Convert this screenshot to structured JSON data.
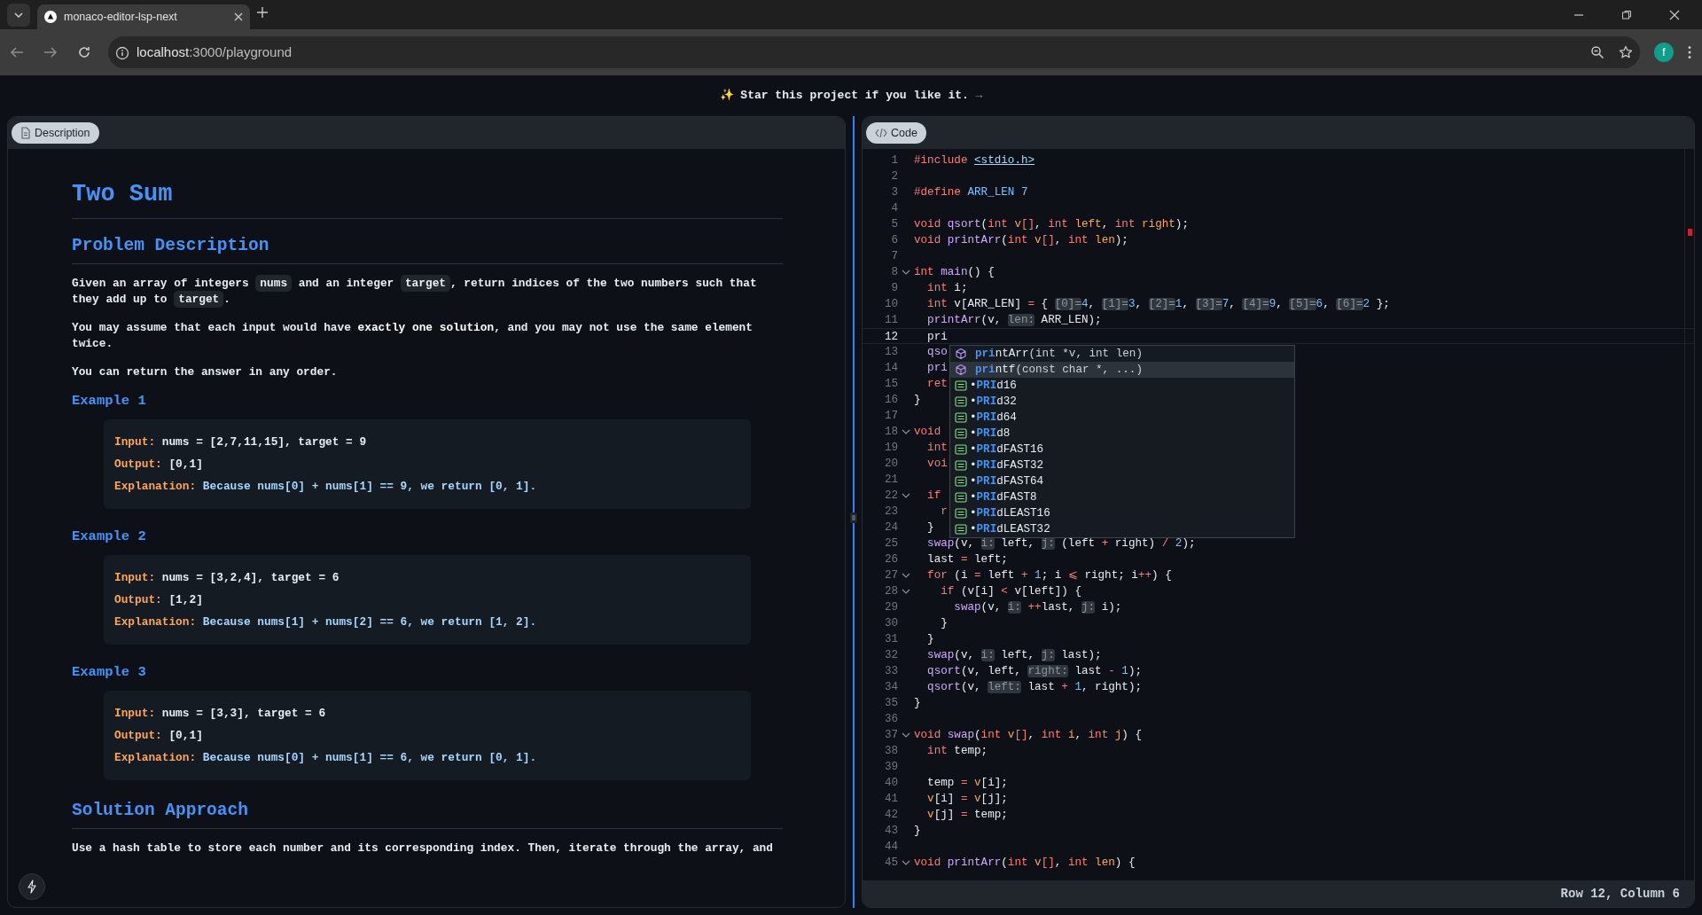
{
  "browser": {
    "tab_title": "monaco-editor-lsp-next",
    "url_host": "localhost",
    "url_path": ":3000/playground",
    "profile_initial": "f"
  },
  "banner": {
    "text": "✨ Star this project if you like it.",
    "arrow": "→"
  },
  "description_panel": {
    "tab": "Description",
    "title": "Two Sum",
    "sections": [
      {
        "kind": "h2",
        "text": "Problem Description"
      },
      {
        "kind": "p",
        "segs": [
          {
            "kind": "text",
            "text": "Given an array of integers "
          },
          {
            "kind": "code",
            "text": "nums"
          },
          {
            "kind": "text",
            "text": " and an integer "
          },
          {
            "kind": "code",
            "text": "target"
          },
          {
            "kind": "text",
            "text": ", return indices of the two numbers such that they add up to "
          },
          {
            "kind": "code",
            "text": "target"
          },
          {
            "kind": "text",
            "text": "."
          }
        ]
      },
      {
        "kind": "p",
        "segs": [
          {
            "kind": "text",
            "text": "You may assume that each input would have "
          },
          {
            "kind": "bold",
            "text": "exactly one solution"
          },
          {
            "kind": "text",
            "text": ", and you may not use the same element twice."
          }
        ]
      },
      {
        "kind": "p",
        "segs": [
          {
            "kind": "text",
            "text": "You can return the answer in any order."
          }
        ]
      },
      {
        "kind": "h3",
        "text": "Example 1"
      },
      {
        "kind": "example",
        "lines": [
          {
            "label": "Input:",
            "value": "nums = [2,7,11,15], target = 9",
            "kind": "plain"
          },
          {
            "label": "Output:",
            "value": "[0,1]",
            "kind": "plain"
          },
          {
            "label": "Explanation:",
            "value": "Because nums[0] + nums[1] == 9, we return [0, 1].",
            "kind": "note"
          }
        ]
      },
      {
        "kind": "h3",
        "text": "Example 2"
      },
      {
        "kind": "example",
        "lines": [
          {
            "label": "Input:",
            "value": "nums = [3,2,4], target = 6",
            "kind": "plain"
          },
          {
            "label": "Output:",
            "value": "[1,2]",
            "kind": "plain"
          },
          {
            "label": "Explanation:",
            "value": "Because nums[1] + nums[2] == 6, we return [1, 2].",
            "kind": "note"
          }
        ]
      },
      {
        "kind": "h3",
        "text": "Example 3"
      },
      {
        "kind": "example",
        "lines": [
          {
            "label": "Input:",
            "value": "nums = [3,3], target = 6",
            "kind": "plain"
          },
          {
            "label": "Output:",
            "value": "[0,1]",
            "kind": "plain"
          },
          {
            "label": "Explanation:",
            "value": "Because nums[0] + nums[1] == 6, we return [0, 1].",
            "kind": "note"
          }
        ]
      },
      {
        "kind": "h2",
        "text": "Solution Approach"
      },
      {
        "kind": "p",
        "segs": [
          {
            "kind": "text",
            "text": "Use a hash table to store each number and its corresponding index. Then, iterate through the array, and"
          }
        ]
      }
    ]
  },
  "code_panel": {
    "tab": "Code",
    "status": "Row 12, Column 6",
    "lines": [
      {
        "n": "1",
        "fold": false,
        "current": false,
        "segs": [
          {
            "kind": "pp",
            "text": "#include "
          },
          {
            "kind": "str",
            "text": "<stdio.h>"
          }
        ]
      },
      {
        "n": "2",
        "fold": false,
        "current": false
      },
      {
        "n": "3",
        "fold": false,
        "current": false,
        "segs": [
          {
            "kind": "pp",
            "text": "#define "
          },
          {
            "kind": "mac",
            "text": "ARR_LEN "
          },
          {
            "kind": "num",
            "text": "7"
          }
        ]
      },
      {
        "n": "4",
        "fold": false,
        "current": false
      },
      {
        "n": "5",
        "fold": false,
        "current": false,
        "segs": [
          {
            "kind": "kw",
            "text": "void "
          },
          {
            "kind": "fn",
            "text": "qsort"
          },
          {
            "kind": "p",
            "text": "("
          },
          {
            "kind": "kw",
            "text": "int "
          },
          {
            "kind": "par",
            "text": "v"
          },
          {
            "kind": "op",
            "text": "[]"
          },
          {
            "kind": "p",
            "text": ", "
          },
          {
            "kind": "kw",
            "text": "int "
          },
          {
            "kind": "par",
            "text": "left"
          },
          {
            "kind": "p",
            "text": ", "
          },
          {
            "kind": "kw",
            "text": "int "
          },
          {
            "kind": "par",
            "text": "right"
          },
          {
            "kind": "p",
            "text": ");"
          }
        ]
      },
      {
        "n": "6",
        "fold": false,
        "current": false,
        "segs": [
          {
            "kind": "kw",
            "text": "void "
          },
          {
            "kind": "fn",
            "text": "printArr"
          },
          {
            "kind": "p",
            "text": "("
          },
          {
            "kind": "kw",
            "text": "int "
          },
          {
            "kind": "par",
            "text": "v"
          },
          {
            "kind": "op",
            "text": "[]"
          },
          {
            "kind": "p",
            "text": ", "
          },
          {
            "kind": "kw",
            "text": "int "
          },
          {
            "kind": "par",
            "text": "len"
          },
          {
            "kind": "p",
            "text": ");"
          }
        ]
      },
      {
        "n": "7",
        "fold": false,
        "current": false
      },
      {
        "n": "8",
        "fold": true,
        "current": false,
        "segs": [
          {
            "kind": "kw",
            "text": "int "
          },
          {
            "kind": "fn",
            "text": "main"
          },
          {
            "kind": "p",
            "text": "() {"
          }
        ]
      },
      {
        "n": "9",
        "fold": false,
        "current": false,
        "segs": [
          {
            "kind": "kw",
            "text": "  int "
          },
          {
            "kind": "p",
            "text": "i;"
          }
        ]
      },
      {
        "n": "10",
        "fold": false,
        "current": false,
        "segs": [
          {
            "kind": "kw",
            "text": "  int "
          },
          {
            "kind": "p",
            "text": "v[ARR_LEN] "
          },
          {
            "kind": "op",
            "text": "="
          },
          {
            "kind": "p",
            "text": " { "
          },
          {
            "kind": "hint",
            "text": "[0]="
          },
          {
            "kind": "num",
            "text": "4"
          },
          {
            "kind": "p",
            "text": ", "
          },
          {
            "kind": "hint",
            "text": "[1]="
          },
          {
            "kind": "num",
            "text": "3"
          },
          {
            "kind": "p",
            "text": ", "
          },
          {
            "kind": "hint",
            "text": "[2]="
          },
          {
            "kind": "num",
            "text": "1"
          },
          {
            "kind": "p",
            "text": ", "
          },
          {
            "kind": "hint",
            "text": "[3]="
          },
          {
            "kind": "num",
            "text": "7"
          },
          {
            "kind": "p",
            "text": ", "
          },
          {
            "kind": "hint",
            "text": "[4]="
          },
          {
            "kind": "num",
            "text": "9"
          },
          {
            "kind": "p",
            "text": ", "
          },
          {
            "kind": "hint",
            "text": "[5]="
          },
          {
            "kind": "num",
            "text": "6"
          },
          {
            "kind": "p",
            "text": ", "
          },
          {
            "kind": "hint",
            "text": "[6]="
          },
          {
            "kind": "num",
            "text": "2"
          },
          {
            "kind": "p",
            "text": " };"
          }
        ]
      },
      {
        "n": "11",
        "fold": false,
        "current": false,
        "segs": [
          {
            "kind": "fn",
            "text": "  printArr"
          },
          {
            "kind": "p",
            "text": "(v, "
          },
          {
            "kind": "hint",
            "text": "len:"
          },
          {
            "kind": "p",
            "text": " ARR_LEN);"
          }
        ]
      },
      {
        "n": "12",
        "fold": false,
        "current": true,
        "segs": [
          {
            "kind": "p",
            "text": "  pri"
          }
        ]
      },
      {
        "n": "13",
        "fold": false,
        "current": false,
        "segs": [
          {
            "kind": "fn",
            "text": "  qso"
          }
        ]
      },
      {
        "n": "14",
        "fold": false,
        "current": false,
        "segs": [
          {
            "kind": "fn",
            "text": "  pri"
          }
        ]
      },
      {
        "n": "15",
        "fold": false,
        "current": false,
        "segs": [
          {
            "kind": "kw",
            "text": "  ret"
          }
        ]
      },
      {
        "n": "16",
        "fold": false,
        "current": false,
        "segs": [
          {
            "kind": "p",
            "text": "}"
          }
        ]
      },
      {
        "n": "17",
        "fold": false,
        "current": false
      },
      {
        "n": "18",
        "fold": true,
        "current": false,
        "segs": [
          {
            "kind": "kw",
            "text": "void"
          }
        ]
      },
      {
        "n": "19",
        "fold": false,
        "current": false,
        "segs": [
          {
            "kind": "kw",
            "text": "  int"
          }
        ]
      },
      {
        "n": "20",
        "fold": false,
        "current": false,
        "segs": [
          {
            "kind": "kw",
            "text": "  voi"
          }
        ]
      },
      {
        "n": "21",
        "fold": false,
        "current": false
      },
      {
        "n": "22",
        "fold": true,
        "current": false,
        "segs": [
          {
            "kind": "kw",
            "text": "  if"
          }
        ]
      },
      {
        "n": "23",
        "fold": false,
        "current": false,
        "segs": [
          {
            "kind": "kw",
            "text": "    r"
          }
        ]
      },
      {
        "n": "24",
        "fold": false,
        "current": false,
        "segs": [
          {
            "kind": "p",
            "text": "  }"
          }
        ]
      },
      {
        "n": "25",
        "fold": false,
        "current": false,
        "segs": [
          {
            "kind": "fn",
            "text": "  swap"
          },
          {
            "kind": "p",
            "text": "(v, "
          },
          {
            "kind": "hint",
            "text": "i:"
          },
          {
            "kind": "p",
            "text": " left, "
          },
          {
            "kind": "hint",
            "text": "j:"
          },
          {
            "kind": "p",
            "text": " (left "
          },
          {
            "kind": "op",
            "text": "+"
          },
          {
            "kind": "p",
            "text": " right) "
          },
          {
            "kind": "op",
            "text": "/"
          },
          {
            "kind": "num",
            "text": " 2"
          },
          {
            "kind": "p",
            "text": ");"
          }
        ]
      },
      {
        "n": "26",
        "fold": false,
        "current": false,
        "segs": [
          {
            "kind": "p",
            "text": "  last "
          },
          {
            "kind": "op",
            "text": "="
          },
          {
            "kind": "p",
            "text": " left;"
          }
        ]
      },
      {
        "n": "27",
        "fold": true,
        "current": false,
        "segs": [
          {
            "kind": "kw",
            "text": "  for "
          },
          {
            "kind": "p",
            "text": "(i "
          },
          {
            "kind": "op",
            "text": "="
          },
          {
            "kind": "p",
            "text": " left "
          },
          {
            "kind": "op",
            "text": "+"
          },
          {
            "kind": "num",
            "text": " 1"
          },
          {
            "kind": "p",
            "text": "; i "
          },
          {
            "kind": "op",
            "text": "⩽"
          },
          {
            "kind": "p",
            "text": " right; i"
          },
          {
            "kind": "op",
            "text": "++"
          },
          {
            "kind": "p",
            "text": ") {"
          }
        ]
      },
      {
        "n": "28",
        "fold": true,
        "current": false,
        "segs": [
          {
            "kind": "kw",
            "text": "    if "
          },
          {
            "kind": "p",
            "text": "(v[i] "
          },
          {
            "kind": "op",
            "text": "<"
          },
          {
            "kind": "p",
            "text": " v[left]) {"
          }
        ]
      },
      {
        "n": "29",
        "fold": false,
        "current": false,
        "segs": [
          {
            "kind": "fn",
            "text": "      swap"
          },
          {
            "kind": "p",
            "text": "(v, "
          },
          {
            "kind": "hint",
            "text": "i:"
          },
          {
            "kind": "op",
            "text": " ++"
          },
          {
            "kind": "p",
            "text": "last, "
          },
          {
            "kind": "hint",
            "text": "j:"
          },
          {
            "kind": "p",
            "text": " i);"
          }
        ]
      },
      {
        "n": "30",
        "fold": false,
        "current": false,
        "segs": [
          {
            "kind": "p",
            "text": "    }"
          }
        ]
      },
      {
        "n": "31",
        "fold": false,
        "current": false,
        "segs": [
          {
            "kind": "p",
            "text": "  }"
          }
        ]
      },
      {
        "n": "32",
        "fold": false,
        "current": false,
        "segs": [
          {
            "kind": "fn",
            "text": "  swap"
          },
          {
            "kind": "p",
            "text": "(v, "
          },
          {
            "kind": "hint",
            "text": "i:"
          },
          {
            "kind": "p",
            "text": " left, "
          },
          {
            "kind": "hint",
            "text": "j:"
          },
          {
            "kind": "p",
            "text": " last);"
          }
        ]
      },
      {
        "n": "33",
        "fold": false,
        "current": false,
        "segs": [
          {
            "kind": "fn",
            "text": "  qsort"
          },
          {
            "kind": "p",
            "text": "(v, left, "
          },
          {
            "kind": "hint",
            "text": "right:"
          },
          {
            "kind": "p",
            "text": " last "
          },
          {
            "kind": "op",
            "text": "-"
          },
          {
            "kind": "num",
            "text": " 1"
          },
          {
            "kind": "p",
            "text": ");"
          }
        ]
      },
      {
        "n": "34",
        "fold": false,
        "current": false,
        "segs": [
          {
            "kind": "fn",
            "text": "  qsort"
          },
          {
            "kind": "p",
            "text": "(v, "
          },
          {
            "kind": "hint",
            "text": "left:"
          },
          {
            "kind": "p",
            "text": " last "
          },
          {
            "kind": "op",
            "text": "+"
          },
          {
            "kind": "num",
            "text": " 1"
          },
          {
            "kind": "p",
            "text": ", right);"
          }
        ]
      },
      {
        "n": "35",
        "fold": false,
        "current": false,
        "segs": [
          {
            "kind": "p",
            "text": "}"
          }
        ]
      },
      {
        "n": "36",
        "fold": false,
        "current": false
      },
      {
        "n": "37",
        "fold": true,
        "current": false,
        "segs": [
          {
            "kind": "kw",
            "text": "void "
          },
          {
            "kind": "fn",
            "text": "swap"
          },
          {
            "kind": "p",
            "text": "("
          },
          {
            "kind": "kw",
            "text": "int "
          },
          {
            "kind": "par",
            "text": "v"
          },
          {
            "kind": "op",
            "text": "[]"
          },
          {
            "kind": "p",
            "text": ", "
          },
          {
            "kind": "kw",
            "text": "int "
          },
          {
            "kind": "par",
            "text": "i"
          },
          {
            "kind": "p",
            "text": ", "
          },
          {
            "kind": "kw",
            "text": "int "
          },
          {
            "kind": "par",
            "text": "j"
          },
          {
            "kind": "p",
            "text": ") {"
          }
        ]
      },
      {
        "n": "38",
        "fold": false,
        "current": false,
        "segs": [
          {
            "kind": "kw",
            "text": "  int "
          },
          {
            "kind": "p",
            "text": "temp;"
          }
        ]
      },
      {
        "n": "39",
        "fold": false,
        "current": false
      },
      {
        "n": "40",
        "fold": false,
        "current": false,
        "segs": [
          {
            "kind": "p",
            "text": "  temp "
          },
          {
            "kind": "op",
            "text": "="
          },
          {
            "kind": "par",
            "text": " v"
          },
          {
            "kind": "p",
            "text": "[i];"
          }
        ]
      },
      {
        "n": "41",
        "fold": false,
        "current": false,
        "segs": [
          {
            "kind": "par",
            "text": "  v"
          },
          {
            "kind": "p",
            "text": "[i] "
          },
          {
            "kind": "op",
            "text": "="
          },
          {
            "kind": "par",
            "text": " v"
          },
          {
            "kind": "p",
            "text": "[j];"
          }
        ]
      },
      {
        "n": "42",
        "fold": false,
        "current": false,
        "segs": [
          {
            "kind": "par",
            "text": "  v"
          },
          {
            "kind": "p",
            "text": "[j] "
          },
          {
            "kind": "op",
            "text": "="
          },
          {
            "kind": "p",
            "text": " temp;"
          }
        ]
      },
      {
        "n": "43",
        "fold": false,
        "current": false,
        "segs": [
          {
            "kind": "p",
            "text": "}"
          }
        ]
      },
      {
        "n": "44",
        "fold": false,
        "current": false
      },
      {
        "n": "45",
        "fold": true,
        "current": false,
        "segs": [
          {
            "kind": "kw",
            "text": "void "
          },
          {
            "kind": "fn",
            "text": "printArr"
          },
          {
            "kind": "p",
            "text": "("
          },
          {
            "kind": "kw",
            "text": "int "
          },
          {
            "kind": "par",
            "text": "v"
          },
          {
            "kind": "op",
            "text": "[]"
          },
          {
            "kind": "p",
            "text": ", "
          },
          {
            "kind": "kw",
            "text": "int "
          },
          {
            "kind": "par",
            "text": "len"
          },
          {
            "kind": "p",
            "text": ") {"
          }
        ]
      }
    ],
    "suggestions": [
      {
        "kind": "function",
        "match": "pri",
        "rest": "ntArr",
        "detail": "(int *v, int len)",
        "selected": false
      },
      {
        "kind": "function",
        "match": "pri",
        "rest": "ntf",
        "detail": "(const char *, ...)",
        "selected": true
      },
      {
        "kind": "constant",
        "bullet": "•",
        "match": "PRI",
        "rest": "d16",
        "selected": false
      },
      {
        "kind": "constant",
        "bullet": "•",
        "match": "PRI",
        "rest": "d32",
        "selected": false
      },
      {
        "kind": "constant",
        "bullet": "•",
        "match": "PRI",
        "rest": "d64",
        "selected": false
      },
      {
        "kind": "constant",
        "bullet": "•",
        "match": "PRI",
        "rest": "d8",
        "selected": false
      },
      {
        "kind": "constant",
        "bullet": "•",
        "match": "PRI",
        "rest": "dFAST16",
        "selected": false
      },
      {
        "kind": "constant",
        "bullet": "•",
        "match": "PRI",
        "rest": "dFAST32",
        "selected": false
      },
      {
        "kind": "constant",
        "bullet": "•",
        "match": "PRI",
        "rest": "dFAST64",
        "selected": false
      },
      {
        "kind": "constant",
        "bullet": "•",
        "match": "PRI",
        "rest": "dFAST8",
        "selected": false
      },
      {
        "kind": "constant",
        "bullet": "•",
        "match": "PRI",
        "rest": "dLEAST16",
        "selected": false
      },
      {
        "kind": "constant",
        "bullet": "•",
        "match": "PRI",
        "rest": "dLEAST32",
        "selected": false
      }
    ]
  }
}
